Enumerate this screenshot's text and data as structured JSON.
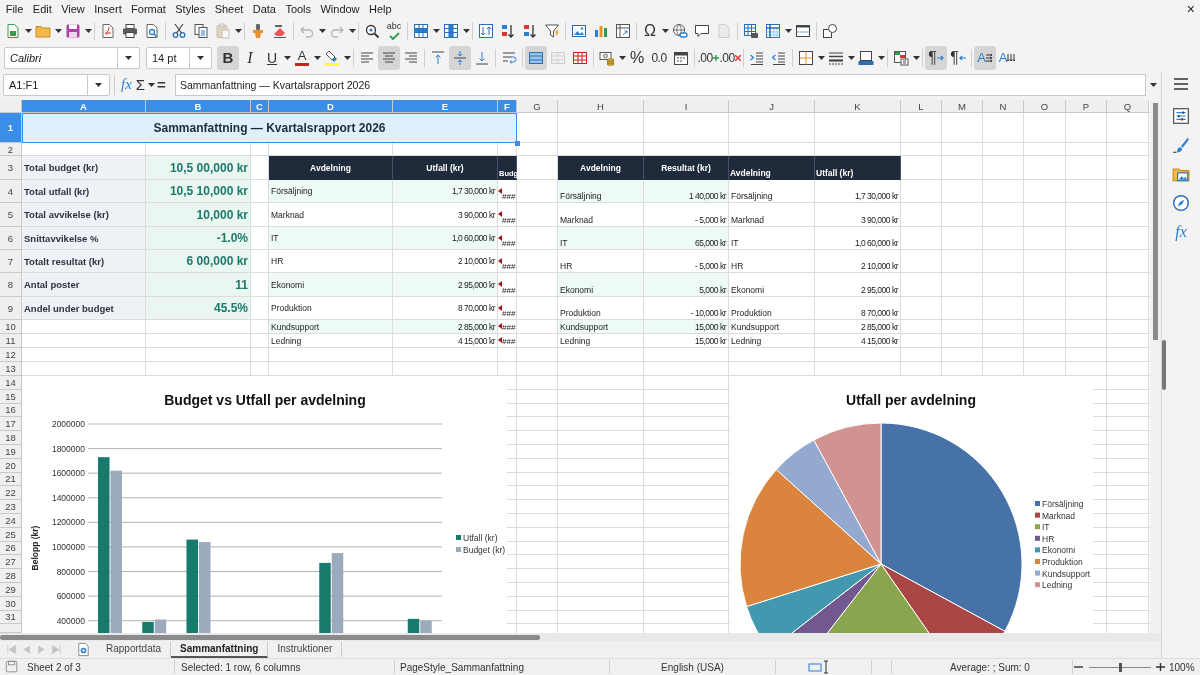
{
  "menu_bar": {
    "items": [
      "File",
      "Edit",
      "View",
      "Insert",
      "Format",
      "Styles",
      "Sheet",
      "Data",
      "Tools",
      "Window",
      "Help"
    ],
    "close": "×"
  },
  "standard_toolbar": [
    {
      "disabled": false
    },
    {
      "disabled": false
    },
    {
      "disabled": false
    },
    {
      "disabled": false
    },
    {
      "disabled": false
    },
    {
      "disabled": false
    },
    {
      "disabled": false
    },
    {
      "disabled": false
    },
    {
      "disabled": true
    },
    {
      "disabled": false
    },
    {
      "disabled": false
    },
    {
      "disabled": true
    },
    {
      "disabled": true
    },
    {
      "disabled": false
    },
    {
      "label": "abc",
      "disabled": false
    },
    {
      "disabled": false
    },
    {
      "disabled": false
    },
    {
      "disabled": false
    },
    {
      "disabled": false
    },
    {
      "disabled": false
    },
    {
      "disabled": false
    },
    {
      "disabled": false
    },
    {
      "disabled": false
    },
    {
      "disabled": false
    },
    {
      "label": "Ω",
      "disabled": false
    },
    {
      "disabled": false
    },
    {
      "disabled": false
    },
    {
      "disabled": true
    },
    {
      "disabled": false
    },
    {
      "disabled": false
    },
    {
      "disabled": false
    },
    {
      "disabled": false
    }
  ],
  "formatting_toolbar": {
    "font_name": "Calibri",
    "font_size": "14 pt",
    "buttons": [
      {
        "label": "B",
        "on": true,
        "disabled": false
      },
      {
        "label": "I",
        "on": false,
        "disabled": false
      },
      {
        "label": "U",
        "on": false,
        "disabled": false
      },
      {
        "label": "A",
        "on": false,
        "disabled": false
      },
      {
        "on": false,
        "disabled": false
      },
      {
        "on": false,
        "disabled": false
      },
      {
        "on": true,
        "disabled": false
      },
      {
        "on": false,
        "disabled": false
      },
      {
        "on": false,
        "disabled": false
      },
      {
        "on": true,
        "disabled": false
      },
      {
        "on": false,
        "disabled": false
      },
      {
        "on": false,
        "disabled": false
      },
      {
        "on": true,
        "disabled": false
      },
      {
        "on": false,
        "disabled": true
      },
      {
        "on": false,
        "disabled": false
      },
      {
        "on": false,
        "disabled": false
      },
      {
        "label": "%",
        "on": false,
        "disabled": false
      },
      {
        "label": "0.0",
        "on": false,
        "disabled": false
      },
      {
        "on": false,
        "disabled": false
      },
      {
        "label": ".00",
        "on": false,
        "disabled": false
      },
      {
        "label": ".00",
        "on": false,
        "disabled": false
      },
      {
        "on": false,
        "disabled": false
      },
      {
        "on": false,
        "disabled": false
      },
      {
        "on": false,
        "disabled": false
      },
      {
        "on": false,
        "disabled": false
      },
      {
        "on": false,
        "disabled": false
      },
      {
        "on": false,
        "disabled": false
      },
      {
        "label": "¶",
        "on": true,
        "disabled": false
      },
      {
        "label": "¶",
        "on": false,
        "disabled": false
      },
      {
        "label": "A",
        "on": true,
        "disabled": false
      },
      {
        "label": "A",
        "on": false,
        "disabled": false
      }
    ]
  },
  "formula_bar": {
    "name_box": "A1:F1",
    "buttons": [
      "fx",
      "Σ",
      "="
    ],
    "content": "Sammanfattning — Kvartalsrapport 2026"
  },
  "sheet": {
    "columns": [
      {
        "label": "A",
        "selected": true
      },
      {
        "label": "B",
        "selected": true
      },
      {
        "label": "C",
        "selected": true
      },
      {
        "label": "D",
        "selected": true
      },
      {
        "label": "E",
        "selected": true
      },
      {
        "label": "F",
        "selected": true
      },
      {
        "label": "G",
        "selected": false
      },
      {
        "label": "H",
        "selected": false
      },
      {
        "label": "I",
        "selected": false
      },
      {
        "label": "J",
        "selected": false
      },
      {
        "label": "K",
        "selected": false
      },
      {
        "label": "L",
        "selected": false
      },
      {
        "label": "M",
        "selected": false
      },
      {
        "label": "N",
        "selected": false
      },
      {
        "label": "O",
        "selected": false
      },
      {
        "label": "P",
        "selected": false
      },
      {
        "label": "Q",
        "selected": false
      }
    ],
    "rows": [
      {
        "label": "1",
        "selected": true
      },
      {
        "label": "2",
        "selected": false
      },
      {
        "label": "3",
        "selected": false
      },
      {
        "label": "4",
        "selected": false
      },
      {
        "label": "5",
        "selected": false
      },
      {
        "label": "6",
        "selected": false
      },
      {
        "label": "7",
        "selected": false
      },
      {
        "label": "8",
        "selected": false
      },
      {
        "label": "9",
        "selected": false
      },
      {
        "label": "10",
        "selected": false
      },
      {
        "label": "11",
        "selected": false
      },
      {
        "label": "12",
        "selected": false
      },
      {
        "label": "13",
        "selected": false
      },
      {
        "label": "14",
        "selected": false
      },
      {
        "label": "15",
        "selected": false
      },
      {
        "label": "16",
        "selected": false
      },
      {
        "label": "17",
        "selected": false
      },
      {
        "label": "18",
        "selected": false
      },
      {
        "label": "19",
        "selected": false
      },
      {
        "label": "20",
        "selected": false
      },
      {
        "label": "21",
        "selected": false
      },
      {
        "label": "22",
        "selected": false
      },
      {
        "label": "23",
        "selected": false
      },
      {
        "label": "24",
        "selected": false
      },
      {
        "label": "25",
        "selected": false
      },
      {
        "label": "26",
        "selected": false
      },
      {
        "label": "27",
        "selected": false
      },
      {
        "label": "28",
        "selected": false
      },
      {
        "label": "29",
        "selected": false
      },
      {
        "label": "30",
        "selected": false
      },
      {
        "label": "31",
        "selected": false
      }
    ],
    "title": "Sammanfattning — Kvartalsrapport 2026",
    "summary": [
      {
        "label": "Total budget (kr)",
        "value": "10,5 00,000 kr"
      },
      {
        "label": "Total utfall (kr)",
        "value": "10,5 10,000 kr"
      },
      {
        "label": "Total avvikelse (kr)",
        "value": "10,000 kr"
      },
      {
        "label": "Snittavvikelse %",
        "value": "-1.0%"
      },
      {
        "label": "Totalt resultat (kr)",
        "value": "6 00,000 kr"
      },
      {
        "label": "Antal poster",
        "value": "11"
      },
      {
        "label": "Andel under budget",
        "value": "45.5%"
      }
    ],
    "department_table": {
      "columns": [
        "Avdelning",
        "Utfall (kr)",
        "Budg"
      ],
      "rows": [
        [
          "Försäljning",
          "1,7 30,000 kr",
          "###"
        ],
        [
          "Marknad",
          "3 90,000 kr",
          "###"
        ],
        [
          "IT",
          "1,0 60,000 kr",
          "###"
        ],
        [
          "HR",
          "2 10,000 kr",
          "###"
        ],
        [
          "Ekonomi",
          "2 95,000 kr",
          "###"
        ],
        [
          "Produktion",
          "8 70,000 kr",
          "###"
        ],
        [
          "Kundsupport",
          "2 85,000 kr",
          "###"
        ],
        [
          "Ledning",
          "4 15,000 kr",
          "###"
        ]
      ]
    },
    "result_table": {
      "columns": [
        "Avdelning",
        "Resultat (kr)"
      ],
      "rows": [
        [
          "Försäljning",
          "1 40,000 kr"
        ],
        [
          "Marknad",
          "- 5,000 kr"
        ],
        [
          "IT",
          "65,000 kr"
        ],
        [
          "HR",
          "- 5,000 kr"
        ],
        [
          "Ekonomi",
          "5,000 kr"
        ],
        [
          "Produktion",
          "- 10,000 kr"
        ],
        [
          "Kundsupport",
          "15,000 kr"
        ],
        [
          "Ledning",
          "15,000 kr"
        ]
      ]
    },
    "outcome_table": {
      "columns": [
        "Avdelning",
        "Utfall (kr)"
      ],
      "rows": [
        [
          "Försäljning",
          "1,7 30,000 kr"
        ],
        [
          "Marknad",
          "3 90,000 kr"
        ],
        [
          "IT",
          "1,0 60,000 kr"
        ],
        [
          "HR",
          "2 10,000 kr"
        ],
        [
          "Ekonomi",
          "2 95,000 kr"
        ],
        [
          "Produktion",
          "8 70,000 kr"
        ],
        [
          "Kundsupport",
          "2 85,000 kr"
        ],
        [
          "Ledning",
          "4 15,000 kr"
        ]
      ]
    },
    "bar_chart": {
      "chart_data": {
        "type": "bar",
        "title": "Budget vs Utfall per avdelning",
        "ylabel": "Belopp (kr)",
        "ylim": [
          300000,
          2000000
        ],
        "yticks": [
          400000,
          600000,
          800000,
          1000000,
          1200000,
          1400000,
          1600000,
          1800000,
          2000000
        ],
        "grid": true,
        "legend": "right",
        "series": [
          {
            "name": "Utfall (kr)",
            "color": "#177a6d",
            "values": [
              1730000,
              390000,
              1060000,
              null,
              null,
              870000,
              null,
              415000
            ]
          },
          {
            "name": "Budget (kr)",
            "color": "#9babbd",
            "values": [
              1620000,
              410000,
              1040000,
              null,
              null,
              950000,
              null,
              400000
            ]
          }
        ]
      }
    },
    "pie_chart": {
      "chart_data": {
        "type": "pie",
        "title": "Utfall per avdelning",
        "legend": "right",
        "categories": [
          "Försäljning",
          "Marknad",
          "IT",
          "HR",
          "Ekonomi",
          "Produktion",
          "Kundsupport",
          "Ledning"
        ],
        "values": [
          32.92,
          7.42,
          20.17,
          4.0,
          5.61,
          16.56,
          5.42,
          7.9
        ],
        "colors": [
          "#4672a8",
          "#aa4643",
          "#89a54e",
          "#71588f",
          "#4198af",
          "#db843d",
          "#93a9cf",
          "#d19392"
        ]
      }
    }
  },
  "sheet_tabs": [
    {
      "label": "Rapportdata",
      "selected": false
    },
    {
      "label": "Sammanfattning",
      "selected": true
    },
    {
      "label": "Instruktioner",
      "selected": false
    }
  ],
  "sidebar": {
    "function_button": "fx"
  },
  "status_bar": {
    "sheet": "Sheet 2 of 3",
    "selection": "Selected: 1 row, 6 columns",
    "page_style": "PageStyle_Sammanfattning",
    "language": "English (USA)",
    "statistics": "Average: ; Sum: 0",
    "zoom": {
      "level": 0.5,
      "reading": "100%"
    }
  }
}
